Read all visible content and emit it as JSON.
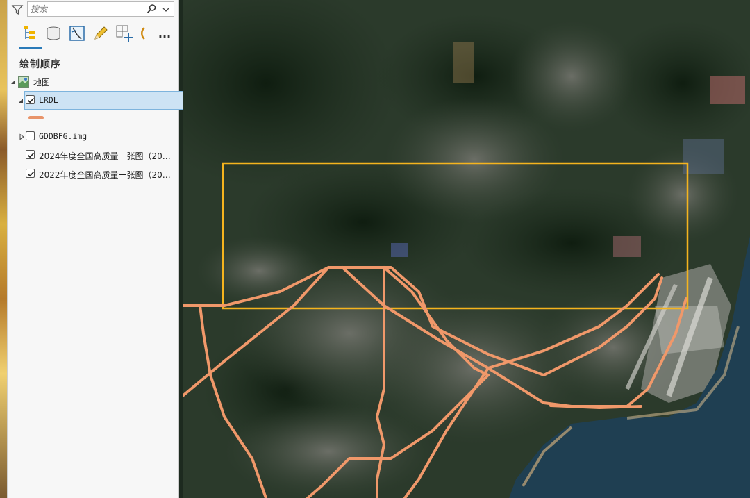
{
  "search": {
    "placeholder": "搜索"
  },
  "toolbar": {
    "items": [
      {
        "icon": "list-by-drawing-order-icon"
      },
      {
        "icon": "list-by-data-source-icon"
      },
      {
        "icon": "list-by-selection-icon"
      },
      {
        "icon": "list-by-editing-icon"
      },
      {
        "icon": "list-by-snapping-icon"
      },
      {
        "icon": "list-by-labeling-icon"
      },
      {
        "icon": "more-icon",
        "label": "..."
      }
    ]
  },
  "contents": {
    "title": "绘制顺序",
    "map": {
      "label": "地图",
      "expanded": true
    },
    "layers": [
      {
        "label": "LRDL",
        "checked": true,
        "expanded": true,
        "selected": true,
        "symbol_color": "#e8946a"
      },
      {
        "label": "GDDBFG.img",
        "checked": false,
        "expanded": false
      },
      {
        "label": "2024年度全国高质量一张图（20…",
        "checked": true
      },
      {
        "label": "2022年度全国高质量一张图（20…",
        "checked": true
      }
    ]
  },
  "map_view": {
    "road_color": "#f0986a",
    "extent_box_color": "#f5b41e",
    "sea_color": "#1f3f52"
  }
}
